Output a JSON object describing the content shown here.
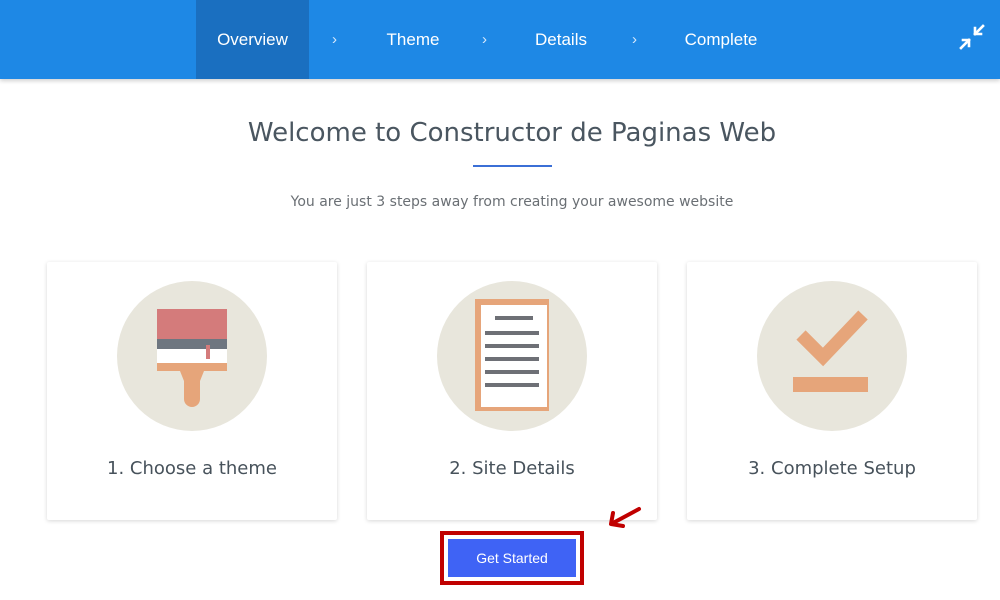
{
  "wizard": {
    "steps": [
      {
        "label": "Overview"
      },
      {
        "label": "Theme"
      },
      {
        "label": "Details"
      },
      {
        "label": "Complete"
      }
    ],
    "separator": "›",
    "active_step": "Overview",
    "collapse_icon": "collapse-icon"
  },
  "main": {
    "title": "Welcome to Constructor de Paginas Web",
    "subtitle": "You are just 3 steps away from creating your awesome website"
  },
  "cards": [
    {
      "label": "1. Choose a theme",
      "icon": "paint-brush-icon"
    },
    {
      "label": "2. Site Details",
      "icon": "clipboard-icon"
    },
    {
      "label": "3. Complete Setup",
      "icon": "checkmark-icon"
    }
  ],
  "action": {
    "button_label": "Get Started"
  },
  "colors": {
    "topbar": "#1e88e5",
    "active_step": "#1a6fc0",
    "button": "#3f63f5",
    "highlight": "#c00000"
  }
}
